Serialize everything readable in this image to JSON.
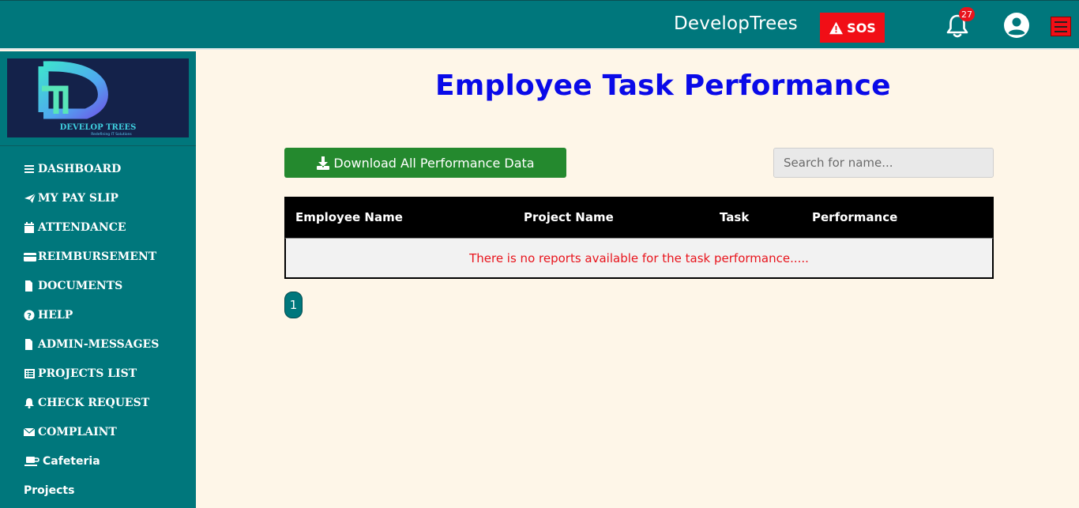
{
  "header": {
    "brand": "DevelopTrees",
    "sos_label": "SOS",
    "notification_count": "27",
    "colors": {
      "bar": "#00777c",
      "sos": "#f10e16",
      "badge": "#e8141c"
    }
  },
  "sidebar": {
    "logo": {
      "mark": "Dt",
      "name": "DEVELOP TREES",
      "tagline": "Redefining IT Solutions"
    },
    "items": [
      {
        "label": "DASHBOARD",
        "icon": "bars-icon"
      },
      {
        "label": "MY PAY SLIP",
        "icon": "paper-plane-icon"
      },
      {
        "label": "ATTENDANCE",
        "icon": "calendar-icon"
      },
      {
        "label": "REIMBURSEMENT",
        "icon": "credit-card-icon"
      },
      {
        "label": "DOCUMENTS",
        "icon": "file-icon"
      },
      {
        "label": "HELP",
        "icon": "question-circle-icon"
      },
      {
        "label": "ADMIN-MESSAGES",
        "icon": "file-icon"
      },
      {
        "label": "PROJECTS LIST",
        "icon": "list-icon"
      },
      {
        "label": "CHECK REQUEST",
        "icon": "bell-icon"
      },
      {
        "label": "COMPLAINT",
        "icon": "envelope-icon"
      },
      {
        "label": "Cafeteria",
        "icon": "coffee-icon"
      },
      {
        "label": "Projects",
        "icon": ""
      }
    ]
  },
  "main": {
    "title": "Employee Task Performance",
    "download_label": "Download All Performance Data",
    "search_placeholder": "Search for name...",
    "table": {
      "columns": [
        "Employee Name",
        "Project Name",
        "Task",
        "Performance"
      ],
      "empty_message": "There is no reports available for the task performance....."
    },
    "pagination": {
      "current_page": "1"
    },
    "colors": {
      "title": "#0a0ae8",
      "download": "#24892e",
      "empty_message": "#e8141c"
    }
  }
}
